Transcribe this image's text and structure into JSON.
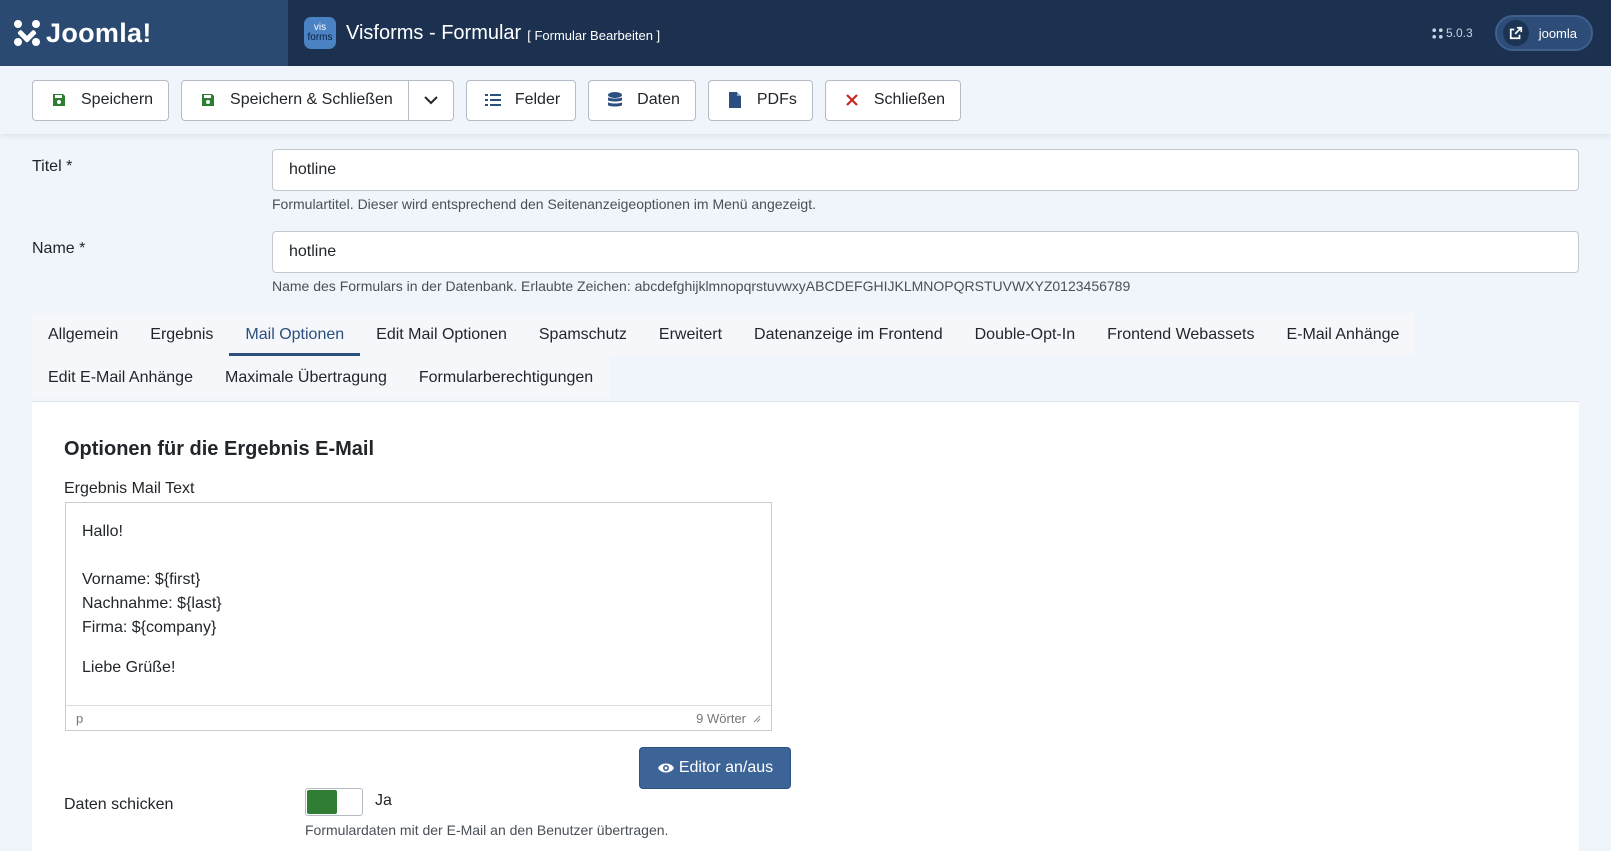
{
  "header": {
    "logo_text": "Joomla!",
    "app_icon_top": "vis",
    "app_icon_bottom": "forms",
    "title": "Visforms - Formular",
    "subtitle": "[ Formular Bearbeiten ]",
    "version": "5.0.3",
    "user_label": "joomla"
  },
  "toolbar": {
    "save": "Speichern",
    "save_close": "Speichern & Schließen",
    "fields": "Felder",
    "data": "Daten",
    "pdfs": "PDFs",
    "close": "Schließen"
  },
  "form": {
    "title_label": "Titel *",
    "title_value": "hotline",
    "title_help": "Formulartitel. Dieser wird entsprechend den Seitenanzeigeoptionen im Menü angezeigt.",
    "name_label": "Name *",
    "name_value": "hotline",
    "name_help": "Name des Formulars in der Datenbank. Erlaubte Zeichen: abcdefghijklmnopqrstuvwxyABCDEFGHIJKLMNOPQRSTUVWXYZ0123456789"
  },
  "tabs_row1": [
    "Allgemein",
    "Ergebnis",
    "Mail Optionen",
    "Edit Mail Optionen",
    "Spamschutz",
    "Erweitert",
    "Datenanzeige im Frontend",
    "Double-Opt-In",
    "Frontend Webassets",
    "E-Mail Anhänge"
  ],
  "tabs_row2": [
    "Edit E-Mail Anhänge",
    "Maximale Übertragung",
    "Formularberechtigungen"
  ],
  "active_tab": "Mail Optionen",
  "panel": {
    "heading": "Optionen für die Ergebnis E-Mail",
    "editor_label": "Ergebnis Mail Text",
    "editor_lines": {
      "l1": "Hallo!",
      "l2": "Vorname: ${first}",
      "l3": "Nachnahme: ${last}",
      "l4": "Firma: ${company}",
      "l5": "Liebe Grüße!"
    },
    "editor_path": "p",
    "word_count": "9 Wörter",
    "toggle_editor": "Editor an/aus",
    "send_data_label": "Daten schicken",
    "send_data_value": "Ja",
    "send_data_help": "Formulardaten mit der E-Mail an den Benutzer übertragen."
  },
  "colors": {
    "header_bg": "#1c3150",
    "accent": "#2a4f80",
    "toggle_on": "#2f7d32",
    "close_icon": "#c52827",
    "save_icon": "#2f7d32"
  }
}
